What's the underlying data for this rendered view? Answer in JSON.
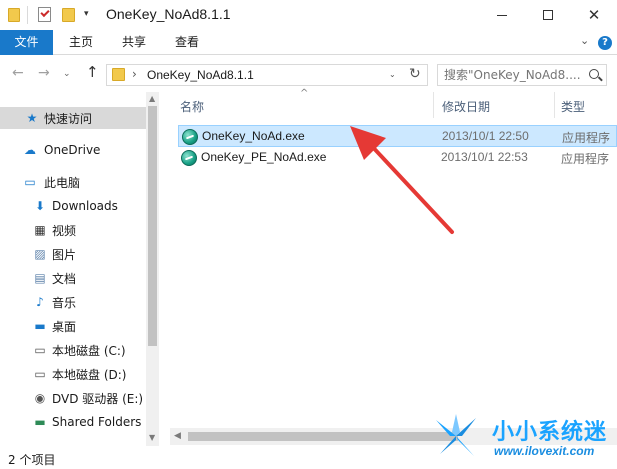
{
  "window": {
    "title": "OneKey_NoAd8.1.1",
    "qa_dropdown": "▾",
    "min_glyph": "",
    "close_glyph": "✕"
  },
  "ribbon": {
    "tabs": [
      {
        "label": "文件"
      },
      {
        "label": "主页"
      },
      {
        "label": "共享"
      },
      {
        "label": "查看"
      }
    ],
    "expand_glyph": "⌄",
    "help_glyph": "?"
  },
  "address": {
    "back_glyph": "←",
    "forward_glyph": "→",
    "recent_glyph": "⌄",
    "up_glyph": "↑",
    "separator": "›",
    "path": "OneKey_NoAd8.1.1",
    "dropdown_glyph": "⌄",
    "refresh_glyph": "↻"
  },
  "search": {
    "placeholder": "搜索\"OneKey_NoAd8....",
    "icon": "search-icon"
  },
  "nav_pane": {
    "items": [
      {
        "label": "快速访问",
        "icon": "star-icon",
        "glyph": "★",
        "color": "#1979ca"
      },
      {
        "label": "OneDrive",
        "icon": "onedrive-icon",
        "glyph": "☁",
        "color": "#1979ca"
      },
      {
        "label": "此电脑",
        "icon": "computer-icon",
        "glyph": "▭",
        "color": "#1979ca"
      },
      {
        "label": "Downloads",
        "icon": "downloads-icon",
        "glyph": "⬇",
        "color": "#1979ca"
      },
      {
        "label": "视频",
        "icon": "video-icon",
        "glyph": "▦",
        "color": "#333333"
      },
      {
        "label": "图片",
        "icon": "pictures-icon",
        "glyph": "▨",
        "color": "#5a7fa8"
      },
      {
        "label": "文档",
        "icon": "documents-icon",
        "glyph": "▤",
        "color": "#5a7fa8"
      },
      {
        "label": "音乐",
        "icon": "music-icon",
        "glyph": "♪",
        "color": "#1979ca"
      },
      {
        "label": "桌面",
        "icon": "desktop-icon",
        "glyph": "▬",
        "color": "#1979ca"
      },
      {
        "label": "本地磁盘 (C:)",
        "icon": "drive-c-icon",
        "glyph": "▭",
        "color": "#555555"
      },
      {
        "label": "本地磁盘 (D:)",
        "icon": "drive-d-icon",
        "glyph": "▭",
        "color": "#555555"
      },
      {
        "label": "DVD 驱动器 (E:)",
        "icon": "dvd-icon",
        "glyph": "◉",
        "color": "#555555"
      },
      {
        "label": "Shared Folders",
        "icon": "network-drive-icon",
        "glyph": "▬",
        "color": "#2e8b57"
      }
    ]
  },
  "columns": {
    "name": "名称",
    "date": "修改日期",
    "type": "类型",
    "sort_glyph": "^"
  },
  "files": [
    {
      "name": "OneKey_NoAd.exe",
      "date": "2013/10/1 22:50",
      "type": "应用程序",
      "selected": true
    },
    {
      "name": "OneKey_PE_NoAd.exe",
      "date": "2013/10/1 22:53",
      "type": "应用程序",
      "selected": false
    }
  ],
  "status": {
    "item_count": "2 个项目"
  },
  "watermark": {
    "brand": "小小系统迷",
    "url": "www.ilovexit.com"
  },
  "colors": {
    "accent": "#1979ca",
    "selection_bg": "#cce8ff",
    "selection_border": "#99d1ff",
    "arrow": "#e53935"
  }
}
